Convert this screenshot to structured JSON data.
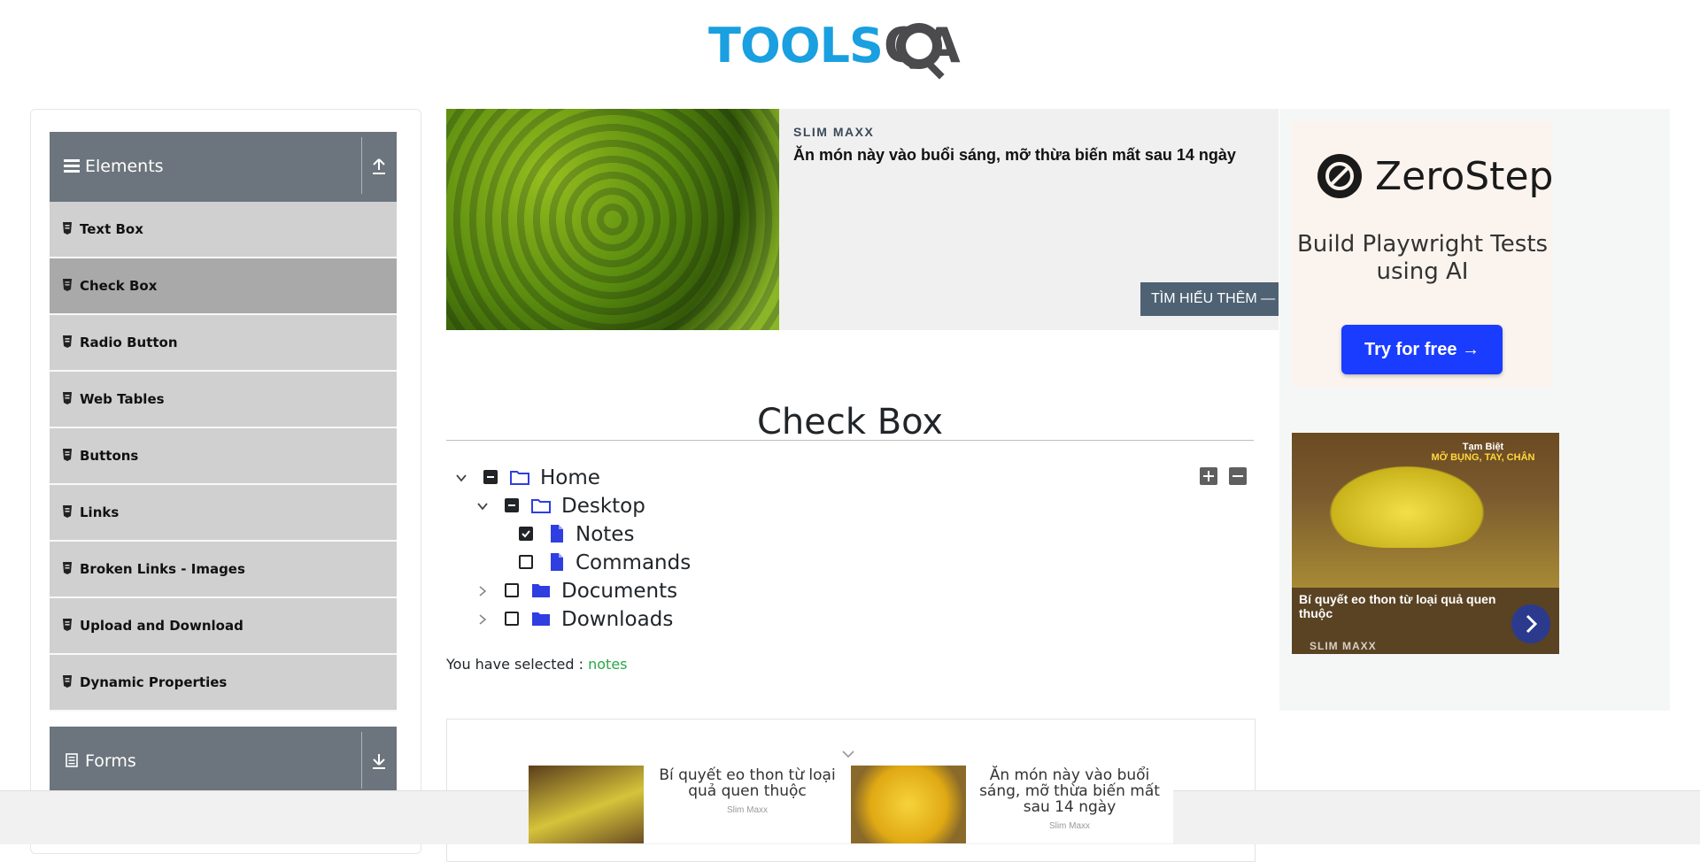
{
  "header": {
    "logo_part1": "TOOLS",
    "logo_part2": "QA"
  },
  "sidebar": {
    "groups": [
      {
        "label": "Elements",
        "toggle": "collapse"
      },
      {
        "label": "Forms",
        "toggle": "expand"
      }
    ],
    "items": [
      {
        "label": "Text Box"
      },
      {
        "label": "Check Box",
        "active": true
      },
      {
        "label": "Radio Button"
      },
      {
        "label": "Web Tables"
      },
      {
        "label": "Buttons"
      },
      {
        "label": "Links"
      },
      {
        "label": "Broken Links - Images"
      },
      {
        "label": "Upload and Download"
      },
      {
        "label": "Dynamic Properties"
      }
    ]
  },
  "top_ad": {
    "brand": "SLIM MAXX",
    "headline": "Ăn món này vào buổi sáng, mỡ thừa biến mất sau 14 ngày",
    "cta": "TÌM HIỂU THÊM —"
  },
  "right_ad": {
    "zerostep_name": "ZeroStep",
    "zerostep_tagline": "Build Playwright Tests using AI",
    "zerostep_button": "Try for free →",
    "banana_promo_title": "Tạm Biệt",
    "banana_promo_sub": "MỠ BỤNG, TAY, CHÂN",
    "banana_title": "Bí quyết eo thon từ loại quả quen thuộc",
    "banana_brand": "SLIM MAXX"
  },
  "main": {
    "title": "Check Box",
    "tree": [
      {
        "label": "Home",
        "state": "partial",
        "expanded": true,
        "type": "folder"
      },
      {
        "label": "Desktop",
        "state": "partial",
        "expanded": true,
        "type": "folder"
      },
      {
        "label": "Notes",
        "state": "checked",
        "type": "file"
      },
      {
        "label": "Commands",
        "state": "unchecked",
        "type": "file"
      },
      {
        "label": "Documents",
        "state": "unchecked",
        "expanded": false,
        "type": "folder"
      },
      {
        "label": "Downloads",
        "state": "unchecked",
        "expanded": false,
        "type": "folder"
      }
    ],
    "expand_all_icon": "plus-square-icon",
    "collapse_all_icon": "minus-square-icon",
    "selected_prefix": "You have selected :",
    "selected_value": "notes"
  },
  "bottom_ad": {
    "items": [
      {
        "title": "Bí quyết eo thon từ loại quả quen thuộc",
        "brand": "Slim Maxx"
      },
      {
        "title": "Ăn món này vào buổi sáng, mỡ thừa biến mất sau 14 ngày",
        "brand": "Slim Maxx"
      }
    ]
  },
  "colors": {
    "logo_blue": "#1a9fe0",
    "logo_gray": "#4b4b4d",
    "group_header": "#6c757d",
    "menu_item": "#d0d0d0",
    "menu_item_active": "#a9a9a9",
    "selected_value": "#28a745",
    "zerostep_button": "#1a3cff"
  }
}
